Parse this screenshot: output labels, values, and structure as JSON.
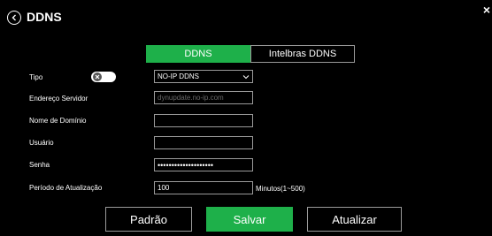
{
  "header": {
    "title": "DDNS",
    "back_icon": "circle-chevron-left-icon",
    "close_icon": "close-icon",
    "close_symbol": "×"
  },
  "tabs": [
    {
      "label": "DDNS",
      "active": true
    },
    {
      "label": "Intelbras DDNS",
      "active": false
    }
  ],
  "form": {
    "tipo": {
      "label": "Tipo",
      "value": "NO-IP DDNS",
      "toggle_on": false
    },
    "endereco_servidor": {
      "label": "Endereço Servidor",
      "placeholder": "dynupdate.no-ip.com",
      "value": ""
    },
    "nome_dominio": {
      "label": "Nome de Domínio",
      "value": ""
    },
    "usuario": {
      "label": "Usuário",
      "value": ""
    },
    "senha": {
      "label": "Senha",
      "value": "••••••••••••••••••••"
    },
    "periodo": {
      "label": "Período de Atualização",
      "value": "100",
      "unit": "Minutos(1~500)"
    }
  },
  "buttons": {
    "padrao": "Padrão",
    "salvar": "Salvar",
    "atualizar": "Atualizar"
  },
  "colors": {
    "accent": "#1eb04a",
    "background": "#000000",
    "border": "#9a9a9a"
  }
}
